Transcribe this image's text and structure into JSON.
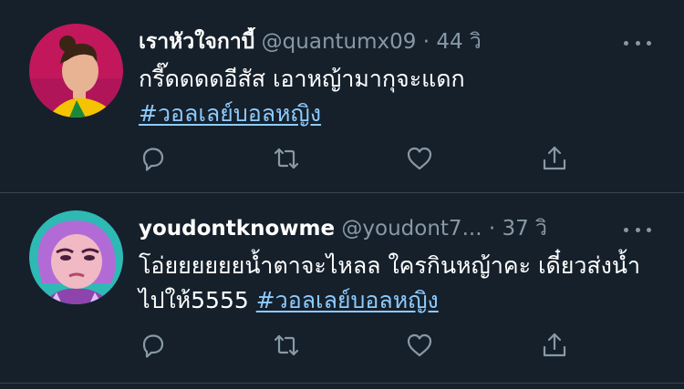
{
  "tweets": [
    {
      "display_name": "เราหัวใจกาบี้",
      "handle": "@quantumx09",
      "separator": "·",
      "time": "44 วิ",
      "text": "กรี๊ดดดดอีสัส เอาหญ้ามากุจะแดก",
      "hashtag": "#วอลเลย์บอลหญิง"
    },
    {
      "display_name": "youdontknowme",
      "handle": "@youdont7...",
      "separator": "·",
      "time": "37 วิ",
      "text": "โอ่ยยยยยยน้ำตาจะไหลล ใครกินหญ้าคะ เดี๋ยวส่งน้ำไปให้5555 ",
      "hashtag": "#วอลเลย์บอลหญิง"
    }
  ],
  "icons": {
    "reply": "reply-icon",
    "retweet": "retweet-icon",
    "like": "like-icon",
    "share": "share-icon",
    "more": "more-icon"
  },
  "colors": {
    "background": "#15202b",
    "secondary_text": "#8899a6",
    "hashtag": "#8ecbff",
    "divider": "#38444d"
  }
}
